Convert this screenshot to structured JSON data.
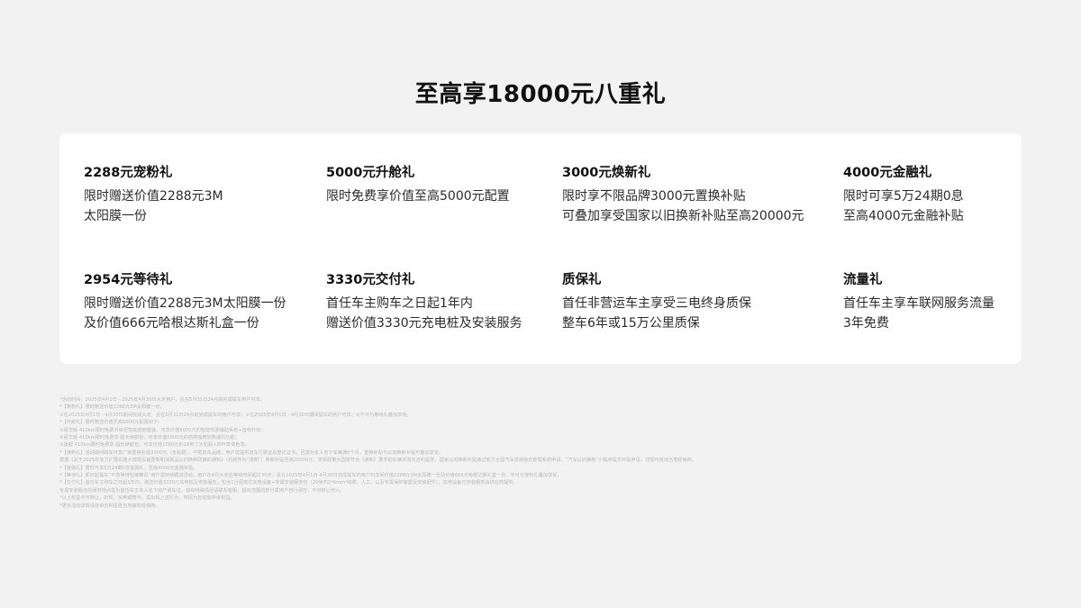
{
  "title": "至高享18000元八重礼",
  "gifts": [
    {
      "title": "2288元宠粉礼",
      "lines": [
        "限时赠送价值2288元3M",
        "太阳膜一份"
      ]
    },
    {
      "title": "5000元升舱礼",
      "lines": [
        "限时免费享价值至高5000元配置"
      ]
    },
    {
      "title": "3000元焕新礼",
      "lines": [
        "限时享不限品牌3000元置换补贴",
        "可叠加享受国家以旧换新补贴至高20000元"
      ]
    },
    {
      "title": "4000元金融礼",
      "lines": [
        "限时可享5万24期0息",
        "至高4000元金融补贴"
      ]
    },
    {
      "title": "2954元等待礼",
      "lines": [
        "限时赠送价值2288元3M太阳膜一份",
        "及价值666元哈根达斯礼盒一份"
      ]
    },
    {
      "title": "3330元交付礼",
      "lines": [
        "首任车主购车之日起1年内",
        "赠送价值3330元充电桩及安装服务"
      ]
    },
    {
      "title": "质保礼",
      "lines": [
        "首任非营运车主享受三电终身质保",
        "整车6年或15万公里质保"
      ]
    },
    {
      "title": "流量礼",
      "lines": [
        "首任车主享车联网服务流量",
        "3年免费"
      ]
    }
  ],
  "footnotes": [
    "*活动时间：2025年4月1日 - 2025年4月30日大定用户，且在5月31日24点前完成提车用户可享。",
    "*【宠粉礼】限时赠送价值2288元3M太阳膜一份。",
    "①在2025年4月1日 - 4月30日期间完成大定，且在5月31日24点前完成提车的用户可享；②在2025年4月1日 - 4月30日期间提车的用户可享；③不可与等待礼叠加享受。",
    "*【升舱礼】限时赠送价值至高5000元配置如下：",
    "①豪华版 410km限时免费升级至智能座舱套装，可享价值5000元的智能驾驶辅助系统+音响升级；",
    "②豪华版 410km限时免费享 超长续航包，可享价值5000元的前排座椅加热通风功能；",
    "③旗舰 410km限时免费享 超长续航包，可享价值1000元的18英寸大轮毂+四叶草变色漆。",
    "*【焕新礼】活动期间购车可享厂家置换补贴3000元（含税费），不限旧车品牌，用户需提供旧车行驶证及登记证书，且需为本人名下车辆满6个月，置换补贴与以旧换新补贴可叠加享受。",
    "根据《关于2025年加力扩围实施大规模设备更新和消费品以旧换新政策的通知》（后称作为“通知”）换新补贴至高20000元，享受政策为国家符合《通知》要求的车辆并购买吉利星愿，国家以旧换新补贴通过官方全国汽车流通信息管理系统申请，“汽车以旧换新”小程序提交补贴申请，详情可咨询当地经销商。",
    "*【金融礼】限时可享5万24期0息金融礼，至高4000元金融补贴。",
    "*【等待礼】即日起提车“不急等待包被推迟”用户需持续跟进活动，用户在4月大定后等待时间超过30天，且在2025年4月1日-4月30日完成提车的用户可享受价值2288元3M太阳膜一份及价值666元哈根达斯礼盒一份，不可与宠粉礼叠加享受。",
    "*【交付礼】首任车主购车之日起1年内，赠送价值3330元充电桩及安装服务，包含1台便携式充电设备+专属安装服务包（20米内2*6mm²线缆、人工、以及专属保护装置及安装配件），充电设备与安装服务由供应商提供。",
    "专属安装服务的服务地点需为首任车主本人名下房产或车位，如有特殊情况请联系客服，超出范围的部分需用户自行承担，不可转让他人。",
    "*以上权益不可转让，折现，买卖或赠与，需出现上述行为，将视为自动放弃该权益。",
    "*更多活动详情请咨询吉利星愿当地授权经销商。"
  ]
}
